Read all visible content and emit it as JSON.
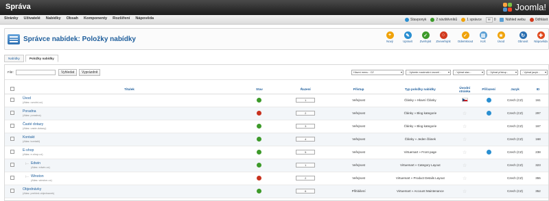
{
  "header": {
    "title": "Správa",
    "logo_text": "Joomla!"
  },
  "menubar": {
    "items": [
      "Stránky",
      "Uživatelé",
      "Nabídky",
      "Obsah",
      "Komponenty",
      "Rozšíření",
      "Nápověda"
    ],
    "status": {
      "site": "Stavponyk",
      "visitors": "2 návštěvníků",
      "admins": "1 správce",
      "messages": "0",
      "view_site": "Náhled webu",
      "logout": "Odhlásit"
    }
  },
  "toolbar": {
    "page_title": "Správce nabídek: Položky nabídky",
    "buttons": [
      {
        "label": "Nový",
        "icon": "new-icon",
        "color": "#f0a30a",
        "glyph": "+"
      },
      {
        "label": "Upravit",
        "icon": "edit-icon",
        "color": "#2a8fd1",
        "glyph": "✎"
      },
      {
        "label": "Zveřejnit",
        "icon": "publish-icon",
        "color": "#3d9a2a",
        "glyph": "✓"
      },
      {
        "label": "Zneveřejnit",
        "icon": "unpublish-icon",
        "color": "#d23a1e",
        "glyph": "○"
      },
      {
        "label": "Odemknout",
        "icon": "checkin-icon",
        "color": "#f0a30a",
        "glyph": "✓"
      },
      {
        "label": "Koš",
        "icon": "trash-icon",
        "color": "#5a9fd4",
        "glyph": "▥"
      },
      {
        "label": "Úvod",
        "icon": "home-icon",
        "color": "#f0a30a",
        "glyph": "★"
      },
      {
        "label": "Obnovit",
        "icon": "refresh-icon",
        "color": "#2a6fb1",
        "glyph": "↻"
      },
      {
        "label": "Nápověda",
        "icon": "help-icon",
        "color": "#e04a1e",
        "glyph": "✚"
      }
    ]
  },
  "tabs": [
    {
      "label": "Nabídky",
      "active": false
    },
    {
      "label": "Položky nabídky",
      "active": true
    }
  ],
  "filter": {
    "label": "Filtr:",
    "search_value": "",
    "search_button": "Vyhledat",
    "clear_button": "Vyprázdnit",
    "selects": [
      "Hlavní menu - CZ",
      "- Vyberte maximální úroveň -",
      "- Vybrat stav -",
      "- Vybrat přístup -",
      "- Vybrat jazyk -"
    ]
  },
  "table": {
    "columns": [
      "Titulek",
      "Stav",
      "Řazení",
      "Přístup",
      "Typ položky nabídky",
      "Úvodní stránka",
      "Přiřazení",
      "Jazyk",
      "ID"
    ],
    "rows": [
      {
        "title": "Úvod",
        "alias": "(Alias: uvodni-cz)",
        "indent": false,
        "published": true,
        "order": "1",
        "access": "Veřejnost",
        "type": "Články » Hlavní Články",
        "home": "flag",
        "assoc": true,
        "language": "Czech (CZ)",
        "id": "161"
      },
      {
        "title": "Poradna",
        "alias": "(Alias: poradna)",
        "indent": false,
        "published": false,
        "order": "2",
        "access": "Veřejnost",
        "type": "Články » Blog kategorie",
        "home": "star",
        "assoc": true,
        "language": "Czech (CZ)",
        "id": "297"
      },
      {
        "title": "Časté dotazy",
        "alias": "(Alias: caste-dotazy)",
        "indent": false,
        "published": true,
        "order": "3",
        "access": "Veřejnost",
        "type": "Články » Blog kategorie",
        "home": "star",
        "assoc": false,
        "language": "Czech (CZ)",
        "id": "167"
      },
      {
        "title": "Kontakt",
        "alias": "(Alias: kontakt)",
        "indent": false,
        "published": true,
        "order": "4",
        "access": "Veřejnost",
        "type": "Články » Jeden článek",
        "home": "star",
        "assoc": false,
        "language": "Czech (CZ)",
        "id": "168"
      },
      {
        "title": "E-shop",
        "alias": "(Alias: e-shop-cz)",
        "indent": false,
        "published": true,
        "order": "5",
        "access": "Veřejnost",
        "type": "Virtuemart » Front page",
        "home": "star",
        "assoc": true,
        "language": "Czech (CZ)",
        "id": "238"
      },
      {
        "title": "Edwin",
        "alias": "(Alias: edwin-cz)",
        "indent": true,
        "published": true,
        "order": "1",
        "access": "Veřejnost",
        "type": "Virtuemart » Category Layout",
        "home": "star",
        "assoc": false,
        "language": "Czech (CZ)",
        "id": "323"
      },
      {
        "title": "Winston",
        "alias": "(Alias: winston-cz)",
        "indent": true,
        "published": false,
        "order": "2",
        "access": "Veřejnost",
        "type": "Virtuemart » Product Details Layout",
        "home": "star",
        "assoc": false,
        "language": "Czech (CZ)",
        "id": "355"
      },
      {
        "title": "Objednávky",
        "alias": "(Alias: prehled-objednavek)",
        "indent": false,
        "published": true,
        "order": "6",
        "access": "Přihlášení",
        "type": "Virtuemart » Account Maintenance",
        "home": "star",
        "assoc": false,
        "language": "Czech (CZ)",
        "id": "352"
      }
    ]
  }
}
